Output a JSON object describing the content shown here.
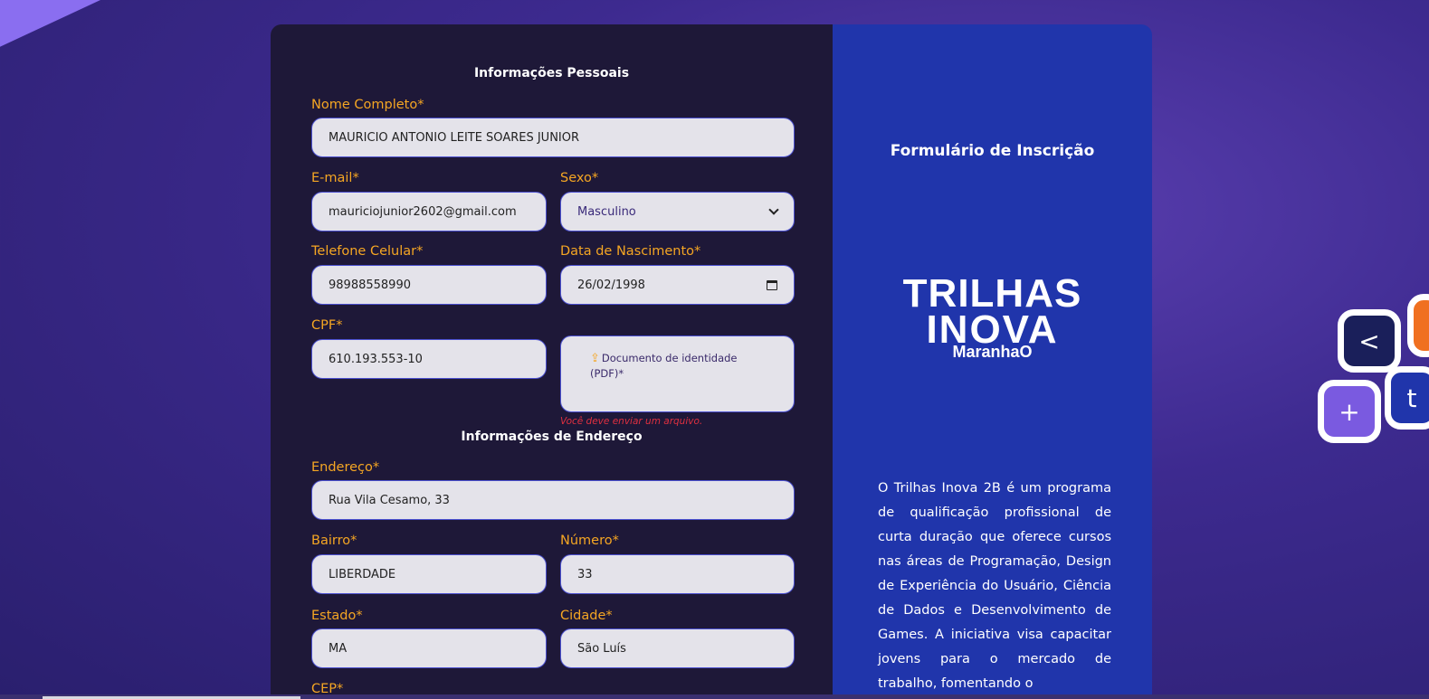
{
  "personal": {
    "section_title": "Informações Pessoais",
    "name_label": "Nome Completo*",
    "name_value": "MAURICIO ANTONIO LEITE SOARES JUNIOR",
    "email_label": "E-mail*",
    "email_value": "mauriciojunior2602@gmail.com",
    "sex_label": "Sexo*",
    "sex_value": "Masculino",
    "phone_label": "Telefone Celular*",
    "phone_value": "98988558990",
    "birth_label": "Data de Nascimento*",
    "birth_value": "26/02/1998",
    "cpf_label": "CPF*",
    "cpf_value": "610.193.553-10",
    "upload_label": "Documento de identidade (PDF)*",
    "upload_error": "Você deve enviar um arquivo."
  },
  "address": {
    "section_title": "Informações de Endereço",
    "street_label": "Endereço*",
    "street_value": "Rua Vila Cesamo, 33",
    "district_label": "Bairro*",
    "district_value": "LIBERDADE",
    "number_label": "Número*",
    "number_value": "33",
    "state_label": "Estado*",
    "state_value": "MA",
    "city_label": "Cidade*",
    "city_value": "São Luís",
    "cep_label": "CEP*"
  },
  "info": {
    "title": "Formulário de Inscrição",
    "logo_line1": "TRILHAS",
    "logo_line2": "INOVA",
    "logo_line3": "MaranhaO",
    "description": "O Trilhas Inova 2B é um programa de qualificação profissional de curta duração que oferece cursos nas áreas de Programação, Design de Experiência do Usuário, Ciência de Dados e Desenvolvimento de Games. A iniciativa visa capacitar jovens para o mercado de trabalho, fomentando o"
  },
  "decor": {
    "hex1_symbol": "<",
    "hex2_symbol": "+",
    "hex3_symbol": "t"
  },
  "colors": {
    "label": "#f5a623",
    "form_bg": "#1e1838",
    "info_bg": "#2035ab",
    "field_bg": "#e4e3ea",
    "error": "#e03040"
  }
}
